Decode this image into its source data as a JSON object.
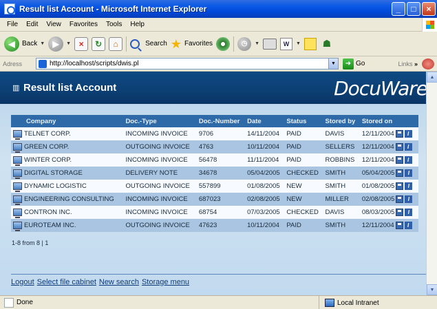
{
  "window": {
    "title": "Result list Account - Microsoft Internet Explorer"
  },
  "menu": [
    "File",
    "Edit",
    "View",
    "Favorites",
    "Tools",
    "Help"
  ],
  "toolbar": {
    "back": "Back",
    "search": "Search",
    "favorites": "Favorites"
  },
  "address": {
    "label": "Adress",
    "url": "http://localhost/scripts/dwis.pl",
    "go": "Go",
    "links": "Links",
    "chevrons": "»"
  },
  "page": {
    "heading": "Result list Account",
    "brand": "DocuWare"
  },
  "table": {
    "headers": [
      "Company",
      "Doc.-Type",
      "Doc.-Number",
      "Date",
      "Status",
      "Stored by",
      "Stored on"
    ],
    "rows": [
      [
        "TELNET CORP.",
        "INCOMING INVOICE",
        "9706",
        "14/11/2004",
        "PAID",
        "DAVIS",
        "12/11/2004"
      ],
      [
        "GREEN CORP.",
        "OUTGOING INVOICE",
        "4763",
        "10/11/2004",
        "PAID",
        "SELLERS",
        "12/11/2004"
      ],
      [
        "WINTER CORP.",
        "INCOMING INVOICE",
        "56478",
        "11/11/2004",
        "PAID",
        "ROBBINS",
        "12/11/2004"
      ],
      [
        "DIGITAL STORAGE",
        "DELIVERY NOTE",
        "34678",
        "05/04/2005",
        "CHECKED",
        "SMITH",
        "05/04/2005"
      ],
      [
        "DYNAMIC LOGISTIC",
        "OUTGOING INVOICE",
        "557899",
        "01/08/2005",
        "NEW",
        "SMITH",
        "01/08/2005"
      ],
      [
        "ENGINEERING CONSULTING",
        "INCOMING INVOICE",
        "687023",
        "02/08/2005",
        "NEW",
        "MILLER",
        "02/08/2005"
      ],
      [
        "CONTRON INC.",
        "INCOMING INVOICE",
        "68754",
        "07/03/2005",
        "CHECKED",
        "DAVIS",
        "08/03/2005"
      ],
      [
        "EUROTEAM INC.",
        "OUTGOING INVOICE",
        "47623",
        "10/11/2004",
        "PAID",
        "SMITH",
        "12/11/2004"
      ]
    ]
  },
  "pager": "1-8 from 8 | 1",
  "bottom_links": [
    "Logout",
    "Select file cabinet",
    "New search",
    "Storage menu"
  ],
  "status": {
    "left": "Done",
    "zone": "Local Intranet"
  },
  "icons": {
    "info": "i"
  },
  "colors": {
    "banner": "#0c3f73",
    "header": "#2f6aa8",
    "row_alt": "#a9c5e2"
  }
}
